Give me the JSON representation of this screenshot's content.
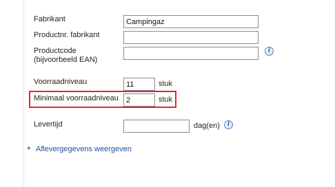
{
  "form": {
    "manufacturer": {
      "label": "Fabrikant",
      "value": "Campingaz"
    },
    "manufacturer_product_no": {
      "label": "Productnr. fabrikant",
      "value": ""
    },
    "product_code": {
      "label": "Productcode (bijvoorbeeld EAN)",
      "value": ""
    },
    "stock_level": {
      "label": "Voorraadniveau",
      "value": "11",
      "unit": "stuk"
    },
    "minimum_stock_level": {
      "label": "Minimaal voorraadniveau",
      "value": "2",
      "unit": "stuk"
    },
    "delivery_time": {
      "label": "Levertijd",
      "value": "",
      "unit": "dag(en)"
    }
  },
  "icons": {
    "product_code_info": "info-icon",
    "delivery_time_info": "info-icon",
    "expand": "plus-icon",
    "info_glyph": "i",
    "plus_glyph": "+"
  },
  "link": {
    "show_delivery_details": "Aflevergegevens weergeven"
  },
  "colors": {
    "highlight": "#e2242b",
    "link": "#1f4fa0",
    "info": "#2b5ea8"
  }
}
